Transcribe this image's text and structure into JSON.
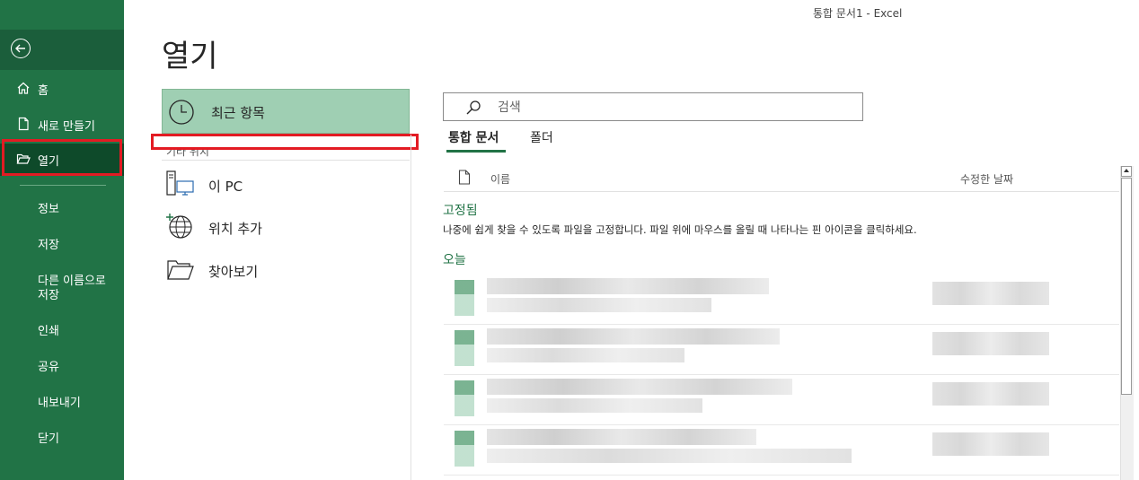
{
  "window_title": "통합 문서1  -  Excel",
  "sidebar": {
    "items": [
      {
        "label": "홈"
      },
      {
        "label": "새로 만들기"
      },
      {
        "label": "열기"
      },
      {
        "label": "정보"
      },
      {
        "label": "저장"
      },
      {
        "label_line1": "다른 이름으로",
        "label_line2": "저장"
      },
      {
        "label": "인쇄"
      },
      {
        "label": "공유"
      },
      {
        "label": "내보내기"
      },
      {
        "label": "닫기"
      }
    ]
  },
  "page_title": "열기",
  "locations": {
    "recent": "최근 항목",
    "other_header": "기타 위치",
    "items": [
      {
        "label": "이 PC",
        "icon": "pc-icon"
      },
      {
        "label": "위치 추가",
        "icon": "globe-add-icon"
      },
      {
        "label": "찾아보기",
        "icon": "folder-icon"
      }
    ]
  },
  "search": {
    "placeholder": "검색"
  },
  "tabs": [
    {
      "label": "통합 문서",
      "selected": true
    },
    {
      "label": "폴더",
      "selected": false
    }
  ],
  "list": {
    "col_name": "이름",
    "col_date": "수정한 날짜",
    "pinned_title": "고정됨",
    "pinned_desc": "나중에 쉽게 찾을 수 있도록 파일을 고정합니다. 파일 위에 마우스를 올릴 때 나타나는 핀 아이콘을 클릭하세요.",
    "today_title": "오늘"
  },
  "colors": {
    "accent": "#217346",
    "sidebar_active": "#0e4a2a",
    "highlight": "#e31b23",
    "recent_bg": "#9fcfb3"
  }
}
